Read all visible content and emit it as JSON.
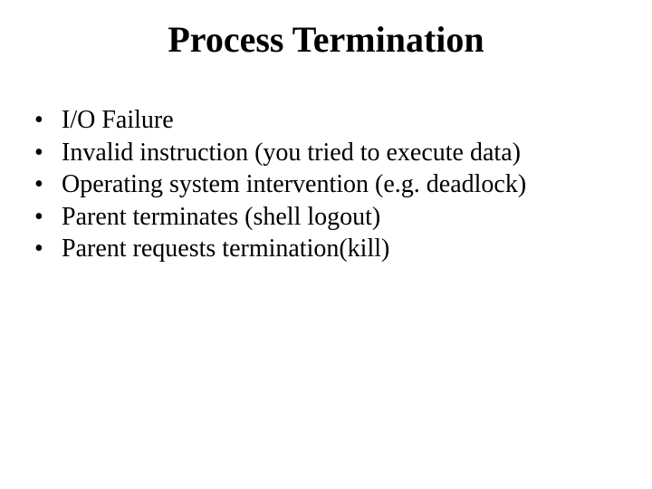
{
  "title": "Process Termination",
  "bullets": [
    "I/O Failure",
    "Invalid instruction (you tried to execute data)",
    "Operating system intervention (e.g. deadlock)",
    "Parent terminates (shell logout)",
    "Parent requests termination(kill)"
  ]
}
